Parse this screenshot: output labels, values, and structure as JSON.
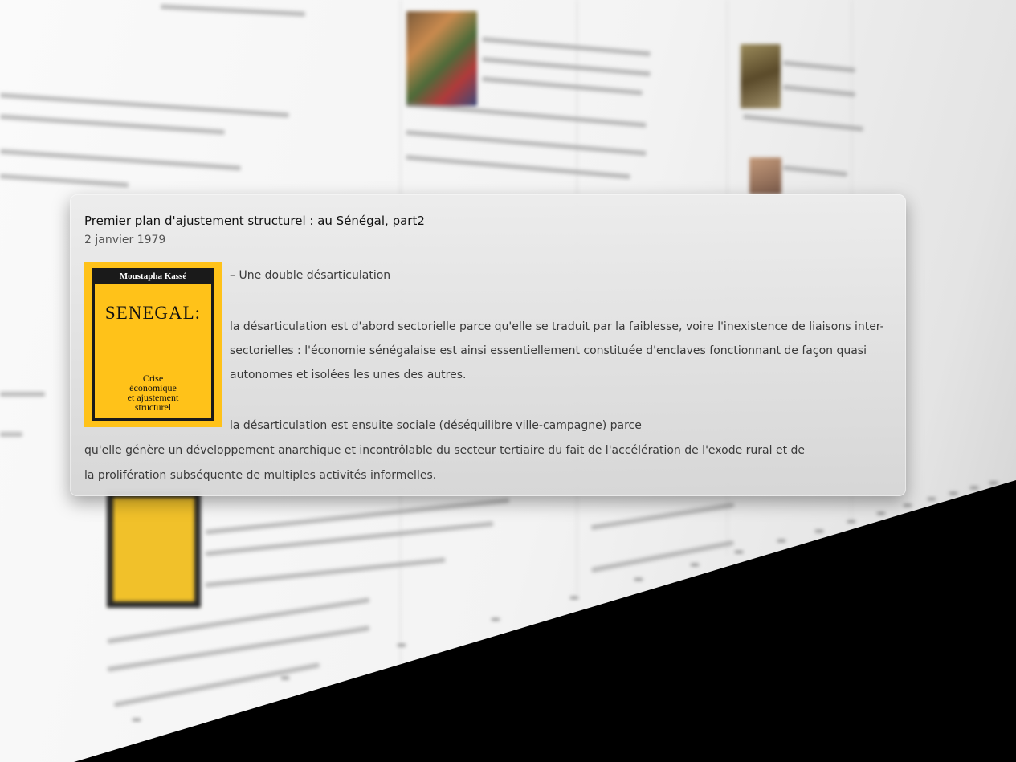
{
  "popup": {
    "title": "Premier plan d'ajustement structurel : au Sénégal, part2",
    "date": "2 janvier 1979",
    "book": {
      "author": "Moustapha Kassé",
      "title": "SENEGAL:",
      "subtitle": "Crise\néconomique\net ajustement\nstructurel",
      "cover_color": "#ffc219"
    },
    "lines": [
      "– Une double désarticulation",
      "la désarticulation est d'abord sectorielle parce qu'elle se traduit par la faiblesse, voire l'inexistence de liaisons inter-",
      "sectorielles : l'économie sénégalaise est ainsi essentiellement constituée d'enclaves fonctionnant de façon quasi",
      "autonomes et isolées les unes des autres.",
      "la désarticulation est ensuite sociale (déséquilibre ville-campagne) parce",
      "qu'elle génère un développement anarchique et incontrôlable du secteur tertiaire du fait de l'accélération de l'exode rural et de",
      "la prolifération subséquente de multiples activités informelles."
    ]
  }
}
